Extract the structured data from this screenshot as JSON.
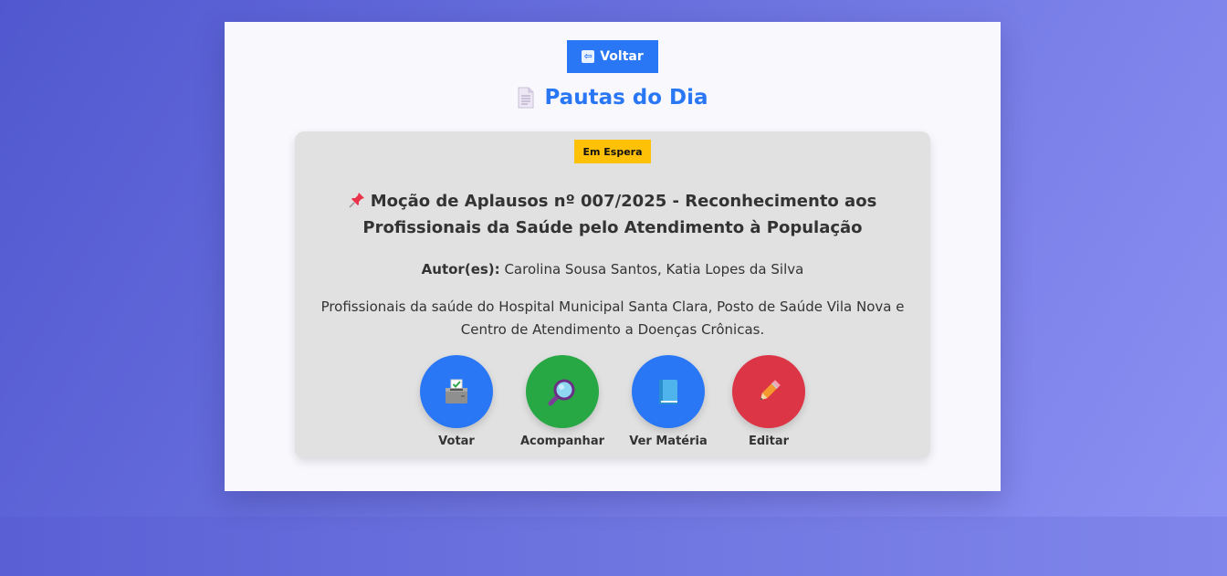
{
  "header": {
    "back_label": "Voltar",
    "back_icon": "arrow-left-icon",
    "page_title": "Pautas do Dia",
    "title_icon": "document-icon"
  },
  "item": {
    "status": "Em Espera",
    "status_color": "#ffc107",
    "title_icon": "pushpin-icon",
    "title": "Moção de Aplausos nº 007/2025 - Reconhecimento aos Profissionais da Saúde pelo Atendimento à População",
    "authors_label": "Autor(es):",
    "authors": "Carolina Sousa Santos, Katia Lopes da Silva",
    "description": "Profissionais da saúde do Hospital Municipal Santa Clara, Posto de Saúde Vila Nova e Centro de Atendimento a Doenças Crônicas."
  },
  "actions": [
    {
      "label": "Votar",
      "icon": "ballot-box-icon",
      "color": "#2a77f5"
    },
    {
      "label": "Acompanhar",
      "icon": "magnifier-icon",
      "color": "#28a745"
    },
    {
      "label": "Ver Matéria",
      "icon": "book-icon",
      "color": "#2a77f5"
    },
    {
      "label": "Editar",
      "icon": "pencil-icon",
      "color": "#dc3545"
    }
  ],
  "colors": {
    "accent": "#2a77f5",
    "card_bg": "#e1e1e1",
    "panel_bg": "#f8f8fd"
  }
}
